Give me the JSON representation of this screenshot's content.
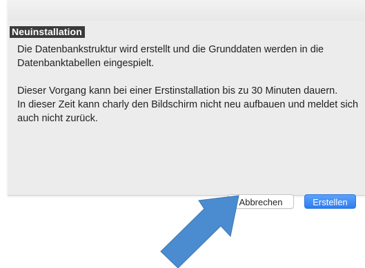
{
  "dialog": {
    "section_title": "Neuinstallation",
    "paragraphs": [
      "Die Datenbankstruktur wird erstellt und die Grunddaten werden in die Datenbanktabellen eingespielt.",
      "Dieser Vorgang kann bei einer Erstinstallation bis zu 30 Minuten dauern.",
      "In dieser Zeit kann charly den Bildschirm nicht neu aufbauen und meldet sich auch nicht zurück."
    ],
    "buttons": {
      "cancel_label": "Abbrechen",
      "create_label": "Erstellen"
    }
  },
  "colors": {
    "primary_button": "#2f7df1",
    "annotation_arrow": "#4a8ccf",
    "section_title_bg": "#3b3b3b"
  },
  "annotation": {
    "icon": "arrow-pointing-up-right-icon"
  }
}
